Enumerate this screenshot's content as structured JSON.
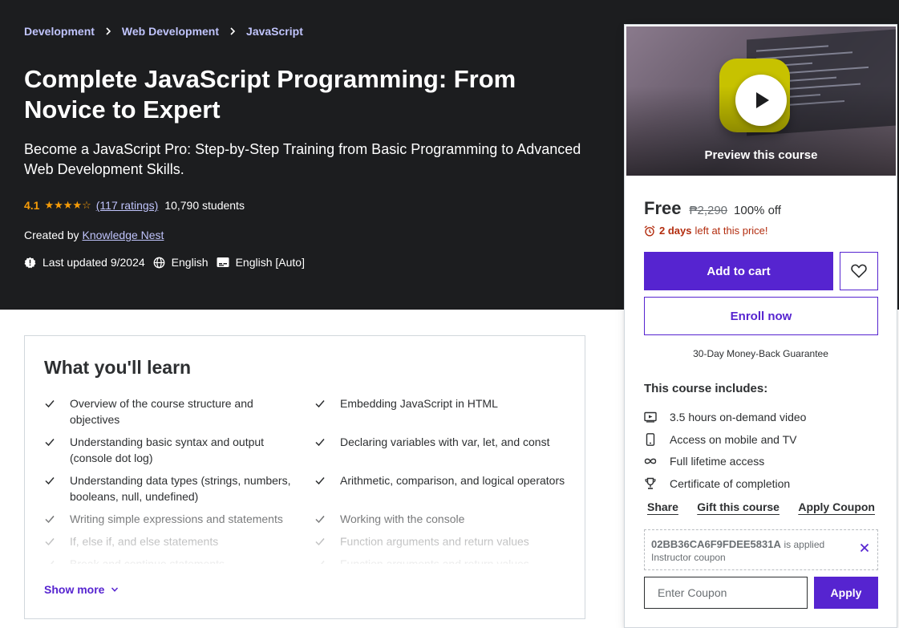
{
  "breadcrumb": [
    "Development",
    "Web Development",
    "JavaScript"
  ],
  "course": {
    "title": "Complete JavaScript Programming: From Novice to Expert",
    "subtitle": "Become a JavaScript Pro: Step-by-Step Training from Basic Programming to Advanced Web Development Skills.",
    "rating": "4.1",
    "rating_stars": 4.1,
    "ratings_count": "(117 ratings)",
    "students": "10,790 students",
    "created_by_label": "Created by",
    "instructor": "Knowledge Nest",
    "last_updated": "Last updated 9/2024",
    "language": "English",
    "captions": "English [Auto]"
  },
  "learn": {
    "heading": "What you'll learn",
    "items": [
      "Overview of the course structure and objectives",
      "Embedding JavaScript in HTML",
      "Understanding basic syntax and output (console dot log)",
      "Declaring variables with var, let, and const",
      "Understanding data types (strings, numbers, booleans, null, undefined)",
      "Arithmetic, comparison, and logical operators",
      "Writing simple expressions and statements",
      "Working with the console",
      "If, else if, and else statements",
      "Function arguments and return values",
      "Break and continue statements",
      "Function arguments and return values"
    ],
    "show_more": "Show more"
  },
  "sidebar": {
    "preview_label": "Preview this course",
    "price": "Free",
    "original_price": "₱2,290",
    "discount": "100% off",
    "timer_bold": "2 days",
    "timer_rest": "left at this price!",
    "add_to_cart": "Add to cart",
    "enroll_now": "Enroll now",
    "guarantee": "30-Day Money-Back Guarantee",
    "includes_title": "This course includes:",
    "includes": [
      {
        "icon": "video-icon",
        "label": "3.5 hours on-demand video"
      },
      {
        "icon": "mobile-icon",
        "label": "Access on mobile and TV"
      },
      {
        "icon": "infinity-icon",
        "label": "Full lifetime access"
      },
      {
        "icon": "trophy-icon",
        "label": "Certificate of completion"
      }
    ],
    "share": "Share",
    "gift": "Gift this course",
    "apply_coupon": "Apply Coupon",
    "coupon_code": "02BB36CA6F9FDEE5831A",
    "coupon_applied": "is applied",
    "coupon_type": "Instructor coupon",
    "coupon_placeholder": "Enter Coupon",
    "apply_button": "Apply"
  },
  "colors": {
    "hero_bg": "#1c1d1f",
    "accent": "#5624d0",
    "link_light": "#c0c4fc",
    "rating": "#f69c08",
    "alert": "#b32d0f"
  }
}
